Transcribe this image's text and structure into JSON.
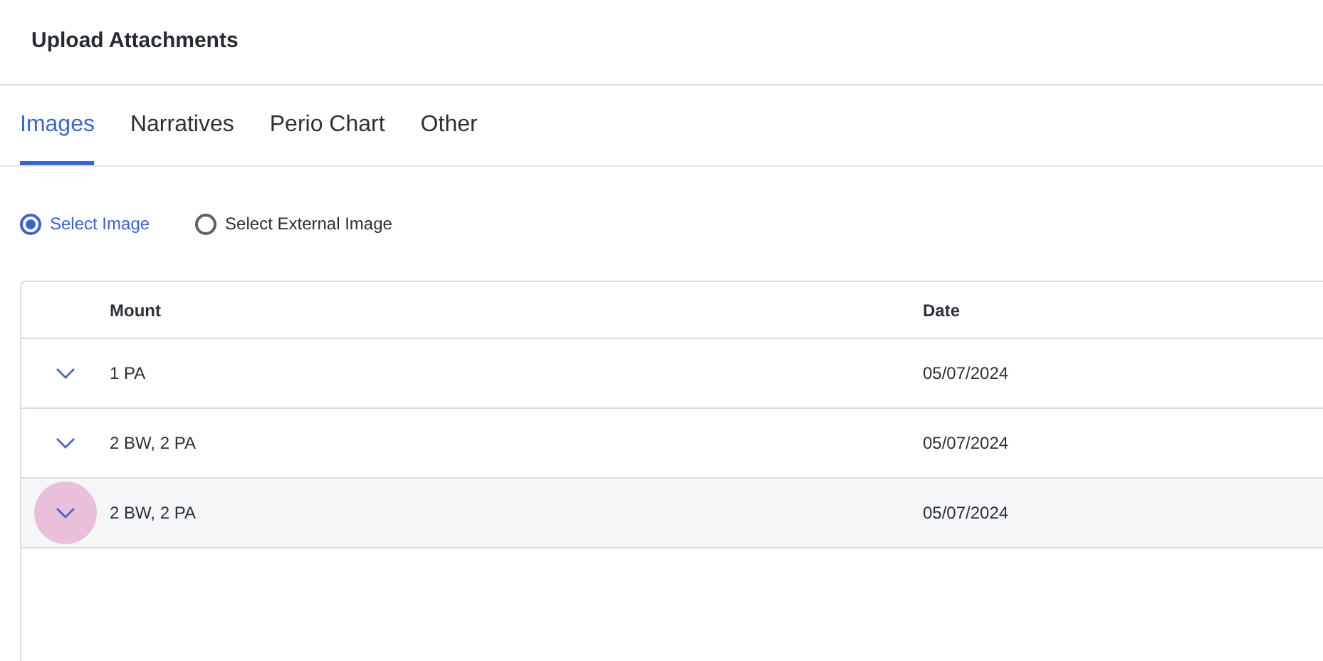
{
  "header": {
    "title": "Upload Attachments"
  },
  "tabs": [
    {
      "label": "Images",
      "selected": true
    },
    {
      "label": "Narratives",
      "selected": false
    },
    {
      "label": "Perio Chart",
      "selected": false
    },
    {
      "label": "Other",
      "selected": false
    }
  ],
  "radios": [
    {
      "label": "Select Image",
      "selected": true
    },
    {
      "label": "Select External Image",
      "selected": false
    }
  ],
  "table": {
    "columns": [
      "Mount",
      "Date"
    ],
    "rows": [
      {
        "mount": "1 PA",
        "date": "05/07/2024",
        "hovered": false
      },
      {
        "mount": "2 BW, 2 PA",
        "date": "05/07/2024",
        "hovered": false
      },
      {
        "mount": "2 BW, 2 PA",
        "date": "05/07/2024",
        "hovered": true
      }
    ]
  }
}
